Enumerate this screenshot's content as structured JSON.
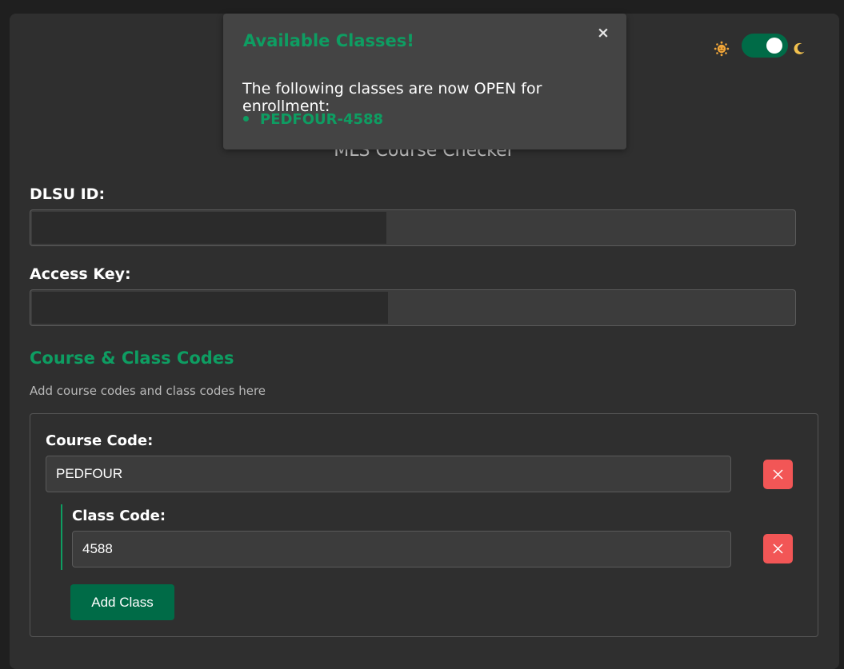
{
  "app": {
    "title": "MLS Course Checker"
  },
  "theme": {
    "toggle_on": true,
    "left_icon": "sun-icon",
    "right_icon": "moon-icon"
  },
  "form": {
    "id_label": "DLSU ID:",
    "key_label": "Access Key:"
  },
  "courses": {
    "heading": "Course & Class Codes",
    "hint": "Add course codes and class codes here",
    "items": [
      {
        "course_label": "Course Code:",
        "course_value": "PEDFOUR",
        "classes": [
          {
            "class_label": "Class Code:",
            "class_value": "4588"
          }
        ],
        "add_class_label": "Add Class"
      }
    ]
  },
  "popup": {
    "title": "Available Classes!",
    "close_glyph": "×",
    "message": "The following classes are now OPEN for enrollment:",
    "open_classes": [
      "PEDFOUR-4588"
    ]
  },
  "colors": {
    "accent_green": "#0e9d62",
    "button_green": "#006b47",
    "danger_red": "#f25656",
    "card_bg": "#2f2f2f",
    "page_bg": "#1f1f1f"
  }
}
